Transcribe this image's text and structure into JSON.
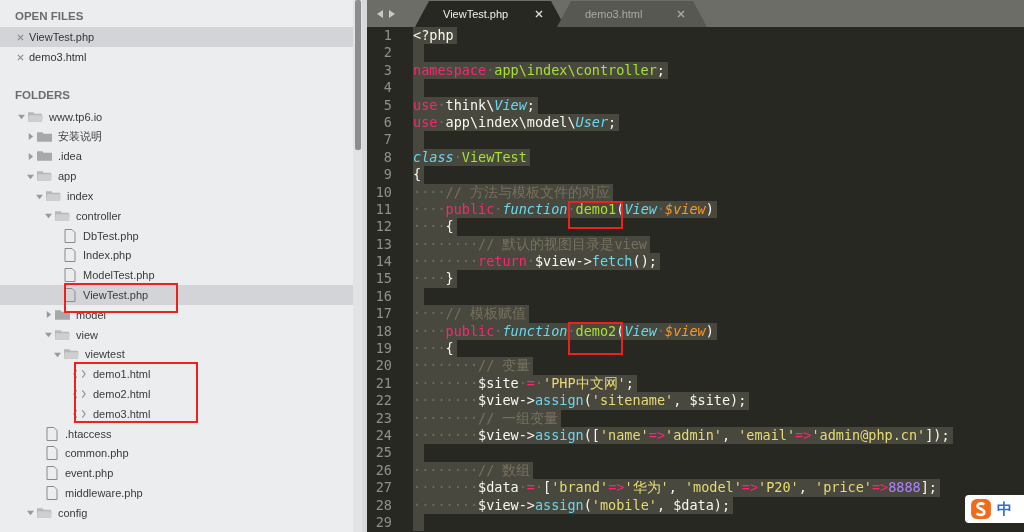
{
  "sidebar": {
    "open_files": {
      "heading": "OPEN FILES",
      "items": [
        {
          "name": "ViewTest.php",
          "selected": true
        },
        {
          "name": "demo3.html",
          "selected": false
        }
      ]
    },
    "folders": {
      "heading": "FOLDERS",
      "tree": [
        {
          "name": "www.tp6.io",
          "kind": "folder",
          "expanded": true,
          "selected": false,
          "children": [
            {
              "name": "安装说明",
              "kind": "folder",
              "expanded": false,
              "selected": false
            },
            {
              "name": ".idea",
              "kind": "folder",
              "expanded": false,
              "selected": false
            },
            {
              "name": "app",
              "kind": "folder",
              "expanded": true,
              "selected": false,
              "children": [
                {
                  "name": "index",
                  "kind": "folder",
                  "expanded": true,
                  "selected": false,
                  "children": [
                    {
                      "name": "controller",
                      "kind": "folder",
                      "expanded": true,
                      "selected": false,
                      "children": [
                        {
                          "name": "DbTest.php",
                          "kind": "file",
                          "selected": false
                        },
                        {
                          "name": "Index.php",
                          "kind": "file",
                          "selected": false
                        },
                        {
                          "name": "ModelTest.php",
                          "kind": "file",
                          "selected": false
                        },
                        {
                          "name": "ViewTest.php",
                          "kind": "file",
                          "selected": true
                        }
                      ]
                    },
                    {
                      "name": "model",
                      "kind": "folder",
                      "expanded": false,
                      "selected": false
                    },
                    {
                      "name": "view",
                      "kind": "folder",
                      "expanded": true,
                      "selected": false,
                      "children": [
                        {
                          "name": "viewtest",
                          "kind": "folder",
                          "expanded": true,
                          "selected": false,
                          "children": [
                            {
                              "name": "demo1.html",
                              "kind": "html",
                              "selected": false
                            },
                            {
                              "name": "demo2.html",
                              "kind": "html",
                              "selected": false
                            },
                            {
                              "name": "demo3.html",
                              "kind": "html",
                              "selected": false
                            }
                          ]
                        }
                      ]
                    }
                  ]
                },
                {
                  "name": ".htaccess",
                  "kind": "file",
                  "selected": false
                },
                {
                  "name": "common.php",
                  "kind": "file",
                  "selected": false
                },
                {
                  "name": "event.php",
                  "kind": "file",
                  "selected": false
                },
                {
                  "name": "middleware.php",
                  "kind": "file",
                  "selected": false
                }
              ]
            },
            {
              "name": "config",
              "kind": "folder",
              "expanded": true,
              "selected": false
            }
          ]
        }
      ]
    }
  },
  "tabs": [
    {
      "label": "ViewTest.php",
      "selected": true
    },
    {
      "label": "demo3.html",
      "selected": false
    }
  ],
  "editor": {
    "lines": [
      {
        "number": "1",
        "selected": true,
        "tokens": [
          {
            "kind": "plain",
            "text": "<?php"
          }
        ]
      },
      {
        "number": "2",
        "selected": true
      },
      {
        "number": "3",
        "selected": true,
        "tokens": [
          {
            "kind": "keyword",
            "text": "namespace"
          },
          {
            "kind": "ws",
            "text": "·"
          },
          {
            "kind": "name",
            "text": "app\\index\\controller"
          },
          {
            "kind": "plain",
            "text": ";"
          }
        ]
      },
      {
        "number": "4",
        "selected": true
      },
      {
        "number": "5",
        "selected": true,
        "tokens": [
          {
            "kind": "keyword",
            "text": "use"
          },
          {
            "kind": "ws",
            "text": "·"
          },
          {
            "kind": "plain",
            "text": "think\\"
          },
          {
            "kind": "type",
            "text": "View"
          },
          {
            "kind": "plain",
            "text": ";"
          }
        ]
      },
      {
        "number": "6",
        "selected": true,
        "tokens": [
          {
            "kind": "keyword",
            "text": "use"
          },
          {
            "kind": "ws",
            "text": "·"
          },
          {
            "kind": "plain",
            "text": "app\\index\\model\\"
          },
          {
            "kind": "type",
            "text": "User"
          },
          {
            "kind": "plain",
            "text": ";"
          }
        ]
      },
      {
        "number": "7",
        "selected": true
      },
      {
        "number": "8",
        "selected": true,
        "tokens": [
          {
            "kind": "storage",
            "text": "class"
          },
          {
            "kind": "ws",
            "text": "·"
          },
          {
            "kind": "name",
            "text": "ViewTest"
          }
        ]
      },
      {
        "number": "9",
        "selected": true,
        "tokens": [
          {
            "kind": "plain",
            "text": "{"
          }
        ]
      },
      {
        "number": "10",
        "selected": true,
        "tokens": [
          {
            "kind": "ws",
            "text": "····"
          },
          {
            "kind": "comment",
            "text": "// 方法与模板文件的对应"
          }
        ]
      },
      {
        "number": "11",
        "selected": true,
        "tokens": [
          {
            "kind": "ws",
            "text": "····"
          },
          {
            "kind": "keyword",
            "text": "public"
          },
          {
            "kind": "ws",
            "text": "·"
          },
          {
            "kind": "storage",
            "text": "function"
          },
          {
            "kind": "ws",
            "text": "·"
          },
          {
            "kind": "name",
            "text": "demo1"
          },
          {
            "kind": "plain",
            "text": "("
          },
          {
            "kind": "type",
            "text": "View"
          },
          {
            "kind": "ws",
            "text": "·"
          },
          {
            "kind": "param",
            "text": "$view"
          },
          {
            "kind": "plain",
            "text": ")"
          }
        ]
      },
      {
        "number": "12",
        "selected": true,
        "tokens": [
          {
            "kind": "ws",
            "text": "····"
          },
          {
            "kind": "plain",
            "text": "{"
          }
        ]
      },
      {
        "number": "13",
        "selected": true,
        "tokens": [
          {
            "kind": "ws",
            "text": "········"
          },
          {
            "kind": "comment",
            "text": "// 默认的视图目录是view"
          }
        ]
      },
      {
        "number": "14",
        "selected": true,
        "tokens": [
          {
            "kind": "ws",
            "text": "········"
          },
          {
            "kind": "keyword",
            "text": "return"
          },
          {
            "kind": "ws",
            "text": "·"
          },
          {
            "kind": "plain",
            "text": "$view->"
          },
          {
            "kind": "builtin",
            "text": "fetch"
          },
          {
            "kind": "plain",
            "text": "();"
          }
        ]
      },
      {
        "number": "15",
        "selected": true,
        "tokens": [
          {
            "kind": "ws",
            "text": "····"
          },
          {
            "kind": "plain",
            "text": "}"
          }
        ]
      },
      {
        "number": "16",
        "selected": true
      },
      {
        "number": "17",
        "selected": true,
        "tokens": [
          {
            "kind": "ws",
            "text": "····"
          },
          {
            "kind": "comment",
            "text": "// 模板赋值"
          }
        ]
      },
      {
        "number": "18",
        "selected": true,
        "tokens": [
          {
            "kind": "ws",
            "text": "····"
          },
          {
            "kind": "keyword",
            "text": "public"
          },
          {
            "kind": "ws",
            "text": "·"
          },
          {
            "kind": "storage",
            "text": "function"
          },
          {
            "kind": "ws",
            "text": "·"
          },
          {
            "kind": "name",
            "text": "demo2"
          },
          {
            "kind": "plain",
            "text": "("
          },
          {
            "kind": "type",
            "text": "View"
          },
          {
            "kind": "ws",
            "text": "·"
          },
          {
            "kind": "param",
            "text": "$view"
          },
          {
            "kind": "plain",
            "text": ")"
          }
        ]
      },
      {
        "number": "19",
        "selected": true,
        "tokens": [
          {
            "kind": "ws",
            "text": "····"
          },
          {
            "kind": "plain",
            "text": "{"
          }
        ]
      },
      {
        "number": "20",
        "selected": true,
        "tokens": [
          {
            "kind": "ws",
            "text": "········"
          },
          {
            "kind": "comment",
            "text": "// 变量"
          }
        ]
      },
      {
        "number": "21",
        "selected": true,
        "tokens": [
          {
            "kind": "ws",
            "text": "········"
          },
          {
            "kind": "plain",
            "text": "$site"
          },
          {
            "kind": "ws",
            "text": "·"
          },
          {
            "kind": "keyword",
            "text": "="
          },
          {
            "kind": "ws",
            "text": "·"
          },
          {
            "kind": "string",
            "text": "'PHP中文网'"
          },
          {
            "kind": "plain",
            "text": ";"
          }
        ]
      },
      {
        "number": "22",
        "selected": true,
        "tokens": [
          {
            "kind": "ws",
            "text": "········"
          },
          {
            "kind": "plain",
            "text": "$view->"
          },
          {
            "kind": "builtin",
            "text": "assign"
          },
          {
            "kind": "plain",
            "text": "("
          },
          {
            "kind": "string",
            "text": "'sitename'"
          },
          {
            "kind": "plain",
            "text": ", $site);"
          }
        ]
      },
      {
        "number": "23",
        "selected": true,
        "tokens": [
          {
            "kind": "ws",
            "text": "········"
          },
          {
            "kind": "comment",
            "text": "// 一组变量"
          }
        ]
      },
      {
        "number": "24",
        "selected": true,
        "tokens": [
          {
            "kind": "ws",
            "text": "········"
          },
          {
            "kind": "plain",
            "text": "$view->"
          },
          {
            "kind": "builtin",
            "text": "assign"
          },
          {
            "kind": "plain",
            "text": "(["
          },
          {
            "kind": "string",
            "text": "'name'"
          },
          {
            "kind": "keyword",
            "text": "=>"
          },
          {
            "kind": "string",
            "text": "'admin'"
          },
          {
            "kind": "plain",
            "text": ", "
          },
          {
            "kind": "string",
            "text": "'email'"
          },
          {
            "kind": "keyword",
            "text": "=>"
          },
          {
            "kind": "string",
            "text": "'admin@php.cn'"
          },
          {
            "kind": "plain",
            "text": "]);"
          }
        ]
      },
      {
        "number": "25",
        "selected": true
      },
      {
        "number": "26",
        "selected": true,
        "tokens": [
          {
            "kind": "ws",
            "text": "········"
          },
          {
            "kind": "comment",
            "text": "// 数组"
          }
        ]
      },
      {
        "number": "27",
        "selected": true,
        "tokens": [
          {
            "kind": "ws",
            "text": "········"
          },
          {
            "kind": "plain",
            "text": "$data"
          },
          {
            "kind": "ws",
            "text": "·"
          },
          {
            "kind": "keyword",
            "text": "="
          },
          {
            "kind": "ws",
            "text": "·"
          },
          {
            "kind": "plain",
            "text": "["
          },
          {
            "kind": "string",
            "text": "'brand'"
          },
          {
            "kind": "keyword",
            "text": "=>"
          },
          {
            "kind": "string",
            "text": "'华为'"
          },
          {
            "kind": "plain",
            "text": ", "
          },
          {
            "kind": "string",
            "text": "'model'"
          },
          {
            "kind": "keyword",
            "text": "=>"
          },
          {
            "kind": "string",
            "text": "'P20'"
          },
          {
            "kind": "plain",
            "text": ", "
          },
          {
            "kind": "string",
            "text": "'price'"
          },
          {
            "kind": "keyword",
            "text": "=>"
          },
          {
            "kind": "number",
            "text": "8888"
          },
          {
            "kind": "plain",
            "text": "];"
          }
        ]
      },
      {
        "number": "28",
        "selected": true,
        "tokens": [
          {
            "kind": "ws",
            "text": "········"
          },
          {
            "kind": "plain",
            "text": "$view->"
          },
          {
            "kind": "builtin",
            "text": "assign"
          },
          {
            "kind": "plain",
            "text": "("
          },
          {
            "kind": "string",
            "text": "'mobile'"
          },
          {
            "kind": "plain",
            "text": ", $data);"
          }
        ]
      },
      {
        "number": "29",
        "selected": true
      }
    ]
  },
  "ime_badge": {
    "label": "中"
  }
}
